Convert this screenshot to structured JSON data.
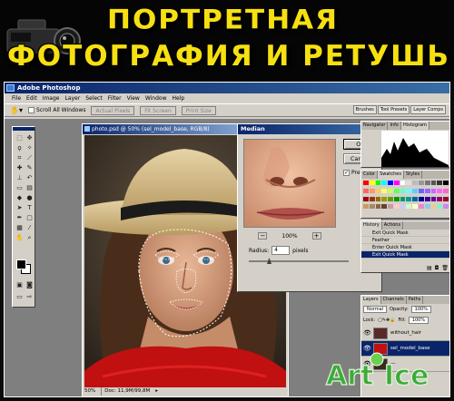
{
  "banner": {
    "line1": "ПОРТРЕТНАЯ",
    "line2": "ФОТОГРАФИЯ И РЕТУШЬ"
  },
  "app": {
    "title": "Adobe Photoshop",
    "menu": [
      "File",
      "Edit",
      "Image",
      "Layer",
      "Select",
      "Filter",
      "View",
      "Window",
      "Help"
    ],
    "options": {
      "scroll_all_windows": "Scroll All Windows",
      "actual_pixels": "Actual Pixels",
      "fit_screen": "Fit Screen",
      "print_size": "Print Size"
    },
    "palette_well_tabs": [
      "Brushes",
      "Tool Presets",
      "Layer Comps"
    ]
  },
  "document": {
    "title": "photo.psd @ 50% (sel_model_base, RGB/8)",
    "zoom": "50%",
    "doc_size": "Doc: 11,9M/99,8M"
  },
  "median_dialog": {
    "title": "Median",
    "close": "x",
    "ok": "OK",
    "cancel": "Cancel",
    "preview_label": "Preview",
    "preview_checked": true,
    "zoom_out": "−",
    "zoom_in": "+",
    "zoom_level": "100%",
    "radius_label": "Radius:",
    "radius_value": "4",
    "radius_unit": "pixels"
  },
  "panels": {
    "navigator_tabs": [
      "Navigator",
      "Info",
      "Histogram"
    ],
    "swatches_tabs": [
      "Color",
      "Swatches",
      "Styles"
    ],
    "history_tabs": [
      "History",
      "Actions"
    ],
    "history_items": [
      "Exit Quick Mask",
      "Feather",
      "Enter Quick Mask",
      "Exit Quick Mask"
    ],
    "history_selected_index": 3,
    "layers_tabs": [
      "Layers",
      "Channels",
      "Paths"
    ],
    "blend_mode": "Normal",
    "opacity_label": "Opacity:",
    "opacity_value": "100%",
    "lock_label": "Lock:",
    "fill_label": "Fill:",
    "fill_value": "100%",
    "layers": [
      "without_hair",
      "sel_model_base",
      "—"
    ]
  },
  "watermark": {
    "text1": "Art",
    "text2": "Ice"
  }
}
